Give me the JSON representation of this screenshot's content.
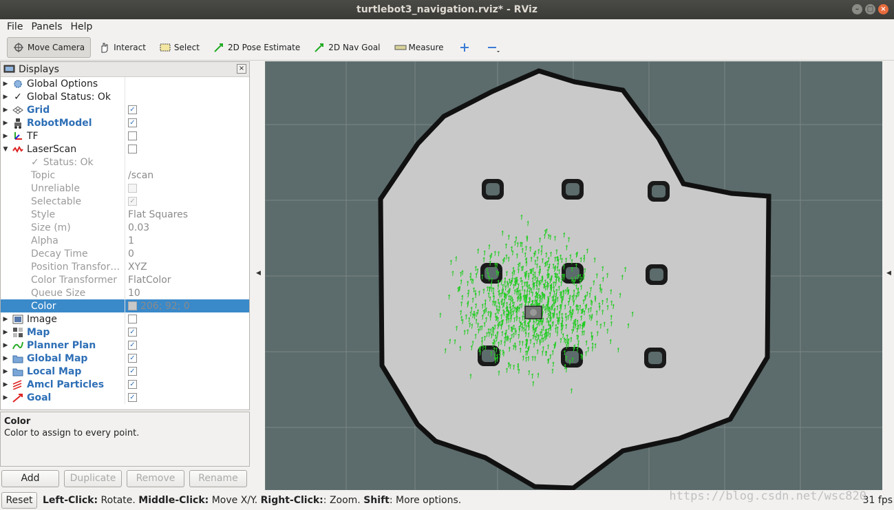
{
  "window": {
    "title": "turtlebot3_navigation.rviz* - RViz"
  },
  "menu": {
    "file": "File",
    "panels": "Panels",
    "help": "Help"
  },
  "toolbar": {
    "move_camera": "Move Camera",
    "interact": "Interact",
    "select": "Select",
    "pose_estimate": "2D Pose Estimate",
    "nav_goal": "2D Nav Goal",
    "measure": "Measure"
  },
  "displays": {
    "title": "Displays",
    "items": [
      {
        "label": "Global Options",
        "value": "",
        "icon": "gear-icon"
      },
      {
        "label": "Global Status: Ok",
        "value": "",
        "icon": "check-icon"
      },
      {
        "label": "Grid",
        "value": "✓",
        "icon": "grid-icon"
      },
      {
        "label": "RobotModel",
        "value": "✓",
        "icon": "robot-icon"
      },
      {
        "label": "TF",
        "value": "",
        "icon": "axes-icon"
      },
      {
        "label": "LaserScan",
        "value": "",
        "icon": "laser-icon"
      },
      {
        "label": "Image",
        "value": "",
        "icon": "image-icon"
      },
      {
        "label": "Map",
        "value": "✓",
        "icon": "map-icon"
      },
      {
        "label": "Planner Plan",
        "value": "✓",
        "icon": "path-icon"
      },
      {
        "label": "Global Map",
        "value": "✓",
        "icon": "folder-icon"
      },
      {
        "label": "Local Map",
        "value": "✓",
        "icon": "folder-icon"
      },
      {
        "label": "Amcl Particles",
        "value": "✓",
        "icon": "arrows-icon"
      },
      {
        "label": "Goal",
        "value": "✓",
        "icon": "arrow-icon"
      }
    ],
    "laserscan_props": [
      {
        "label": "Status: Ok",
        "value": ""
      },
      {
        "label": "Topic",
        "value": "/scan"
      },
      {
        "label": "Unreliable",
        "value": ""
      },
      {
        "label": "Selectable",
        "value": "✓"
      },
      {
        "label": "Style",
        "value": "Flat Squares"
      },
      {
        "label": "Size (m)",
        "value": "0.03"
      },
      {
        "label": "Alpha",
        "value": "1"
      },
      {
        "label": "Decay Time",
        "value": "0"
      },
      {
        "label": "Position Transfor…",
        "value": "XYZ"
      },
      {
        "label": "Color Transformer",
        "value": "FlatColor"
      },
      {
        "label": "Queue Size",
        "value": "10"
      },
      {
        "label": "Color",
        "value": "206; 92; 0"
      }
    ]
  },
  "description": {
    "title": "Color",
    "text": "Color to assign to every point."
  },
  "buttons": {
    "add": "Add",
    "duplicate": "Duplicate",
    "remove": "Remove",
    "rename": "Rename"
  },
  "status": {
    "reset": "Reset",
    "left_click": "Left-Click:",
    "rotate": " Rotate. ",
    "middle_click": "Middle-Click:",
    "move": " Move X/Y. ",
    "right_click": "Right-Click:",
    "zoom": ": Zoom. ",
    "shift": "Shift",
    "more": ": More options.",
    "fps": "31 fps"
  },
  "watermark": "https://blog.csdn.net/wsc820",
  "colors": {
    "particles": "#22cc22",
    "map_free": "#c9c9c9",
    "map_unknown": "#5c6b6b",
    "wall": "#111111",
    "selection": "#3a89c9",
    "laser_color_swatch": "#ce5c00"
  }
}
